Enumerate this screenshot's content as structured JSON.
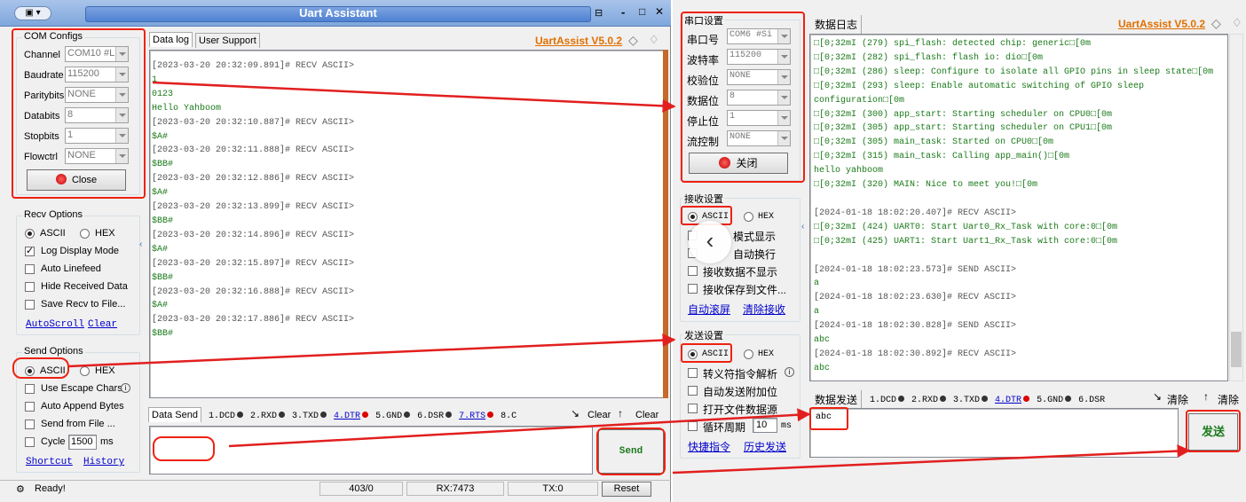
{
  "left": {
    "title": "Uart Assistant",
    "win_controls": [
      "-",
      "□",
      "✕"
    ],
    "com": {
      "title": "COM Configs",
      "rows": [
        {
          "label": "Channel",
          "value": "COM10 #L"
        },
        {
          "label": "Baudrate",
          "value": "115200"
        },
        {
          "label": "Paritybits",
          "value": "NONE"
        },
        {
          "label": "Databits",
          "value": "8"
        },
        {
          "label": "Stopbits",
          "value": "1"
        },
        {
          "label": "Flowctrl",
          "value": "NONE"
        }
      ],
      "close": "Close"
    },
    "recv": {
      "title": "Recv Options",
      "ascii": "ASCII",
      "hex": "HEX",
      "opts": [
        "Log Display Mode",
        "Auto Linefeed",
        "Hide Received Data",
        "Save Recv to File..."
      ],
      "autoscroll": "AutoScroll",
      "clear": "Clear"
    },
    "send": {
      "title": "Send Options",
      "ascii": "ASCII",
      "hex": "HEX",
      "opts": [
        "Use Escape Chars",
        "Auto Append Bytes",
        "Send from File ...",
        "Cycle"
      ],
      "cycle_value": "1500",
      "cycle_unit": "ms",
      "shortcut": "Shortcut",
      "history": "History"
    },
    "tabs": {
      "datalog": "Data log",
      "support": "User Support"
    },
    "version": "UartAssist V5.0.2",
    "log": [
      {
        "t": "[2023-03-20 20:32:09.891]# RECV ASCII>",
        "c": "d"
      },
      {
        "t": "1",
        "c": "g"
      },
      {
        "t": "0123",
        "c": "g"
      },
      {
        "t": "Hello Yahboom",
        "c": "g"
      },
      {
        "t": "[2023-03-20 20:32:10.887]# RECV ASCII>",
        "c": "d"
      },
      {
        "t": "$A#",
        "c": "g"
      },
      {
        "t": "[2023-03-20 20:32:11.888]# RECV ASCII>",
        "c": "d"
      },
      {
        "t": "$BB#",
        "c": "g"
      },
      {
        "t": "[2023-03-20 20:32:12.886]# RECV ASCII>",
        "c": "d"
      },
      {
        "t": "$A#",
        "c": "g"
      },
      {
        "t": "[2023-03-20 20:32:13.899]# RECV ASCII>",
        "c": "d"
      },
      {
        "t": "$BB#",
        "c": "g"
      },
      {
        "t": "[2023-03-20 20:32:14.896]# RECV ASCII>",
        "c": "d"
      },
      {
        "t": "$A#",
        "c": "g"
      },
      {
        "t": "[2023-03-20 20:32:15.897]# RECV ASCII>",
        "c": "d"
      },
      {
        "t": "$BB#",
        "c": "g"
      },
      {
        "t": "[2023-03-20 20:32:16.888]# RECV ASCII>",
        "c": "d"
      },
      {
        "t": "$A#",
        "c": "g"
      },
      {
        "t": "[2023-03-20 20:32:17.886]# RECV ASCII>",
        "c": "d"
      },
      {
        "t": "$BB#",
        "c": "g"
      }
    ],
    "sendbar": {
      "tab": "Data Send",
      "signals": [
        "1.DCD",
        "2.RXD",
        "3.TXD",
        "4.DTR",
        "5.GND",
        "6.DSR",
        "7.RTS",
        "8.C"
      ],
      "clear1": "Clear",
      "clear2": "Clear"
    },
    "send_button": "Send",
    "status": {
      "ready": "Ready!",
      "counter": "403/0",
      "rx": "RX:7473",
      "tx": "TX:0",
      "reset": "Reset"
    }
  },
  "right": {
    "serial": {
      "title": "串口设置",
      "rows": [
        {
          "label": "串口号",
          "value": "COM6 #Si"
        },
        {
          "label": "波特率",
          "value": "115200"
        },
        {
          "label": "校验位",
          "value": "NONE"
        },
        {
          "label": "数据位",
          "value": "8"
        },
        {
          "label": "停止位",
          "value": "1"
        },
        {
          "label": "流控制",
          "value": "NONE"
        }
      ],
      "close": "关闭"
    },
    "recv": {
      "title": "接收设置",
      "ascii": "ASCII",
      "hex": "HEX",
      "opts": [
        "模式显示",
        "自动换行",
        "接收数据不显示",
        "接收保存到文件..."
      ],
      "autoscroll": "自动滚屏",
      "clear": "清除接收"
    },
    "send": {
      "title": "发送设置",
      "ascii": "ASCII",
      "hex": "HEX",
      "opts": [
        "转义符指令解析",
        "自动发送附加位",
        "打开文件数据源",
        "循环周期"
      ],
      "cycle_value": "10",
      "cycle_unit": "ms",
      "shortcut": "快捷指令",
      "history": "历史发送"
    },
    "log_tab": "数据日志",
    "version": "UartAssist V5.0.2",
    "log": [
      {
        "t": "□[0;32mI (279) spi_flash: detected chip: generic□[0m",
        "c": "g"
      },
      {
        "t": "□[0;32mI (282) spi_flash: flash io: dio□[0m",
        "c": "g"
      },
      {
        "t": "□[0;32mI (286) sleep: Configure to isolate all GPIO pins in sleep state□[0m",
        "c": "g"
      },
      {
        "t": "□[0;32mI (293) sleep: Enable automatic switching of GPIO sleep",
        "c": "g"
      },
      {
        "t": "configuration□[0m",
        "c": "g"
      },
      {
        "t": "□[0;32mI (300) app_start: Starting scheduler on CPU0□[0m",
        "c": "g"
      },
      {
        "t": "□[0;32mI (305) app_start: Starting scheduler on CPU1□[0m",
        "c": "g"
      },
      {
        "t": "□[0;32mI (305) main_task: Started on CPU0□[0m",
        "c": "g"
      },
      {
        "t": "□[0;32mI (315) main_task: Calling app_main()□[0m",
        "c": "g"
      },
      {
        "t": "hello yahboom",
        "c": "g"
      },
      {
        "t": "□[0;32mI (320) MAIN: Nice to meet you!□[0m",
        "c": "g"
      },
      {
        "t": "",
        "c": "g"
      },
      {
        "t": "[2024-01-18 18:02:20.407]# RECV ASCII>",
        "c": "d"
      },
      {
        "t": "□[0;32mI (424) UART0: Start Uart0_Rx_Task with core:0□[0m",
        "c": "g"
      },
      {
        "t": "□[0;32mI (425) UART1: Start Uart1_Rx_Task with core:0□[0m",
        "c": "g"
      },
      {
        "t": "",
        "c": "g"
      },
      {
        "t": "[2024-01-18 18:02:23.573]# SEND ASCII>",
        "c": "d"
      },
      {
        "t": "a",
        "c": "g"
      },
      {
        "t": "[2024-01-18 18:02:23.630]# RECV ASCII>",
        "c": "d"
      },
      {
        "t": "a",
        "c": "g"
      },
      {
        "t": "[2024-01-18 18:02:30.828]# SEND ASCII>",
        "c": "d"
      },
      {
        "t": "abc",
        "c": "g"
      },
      {
        "t": "[2024-01-18 18:02:30.892]# RECV ASCII>",
        "c": "d"
      },
      {
        "t": "abc",
        "c": "g"
      }
    ],
    "sendbar": {
      "tab": "数据发送",
      "signals": [
        "1.DCD",
        "2.RXD",
        "3.TXD",
        "4.DTR",
        "5.GND",
        "6.DSR"
      ],
      "clear1": "清除",
      "clear2": "清除"
    },
    "send_text": "abc",
    "send_button": "发送"
  },
  "colors": {
    "accent": "#e21f1f",
    "title_blue": "#2a63c9",
    "version": "#e07000",
    "log_green": "#1a7a1a"
  }
}
